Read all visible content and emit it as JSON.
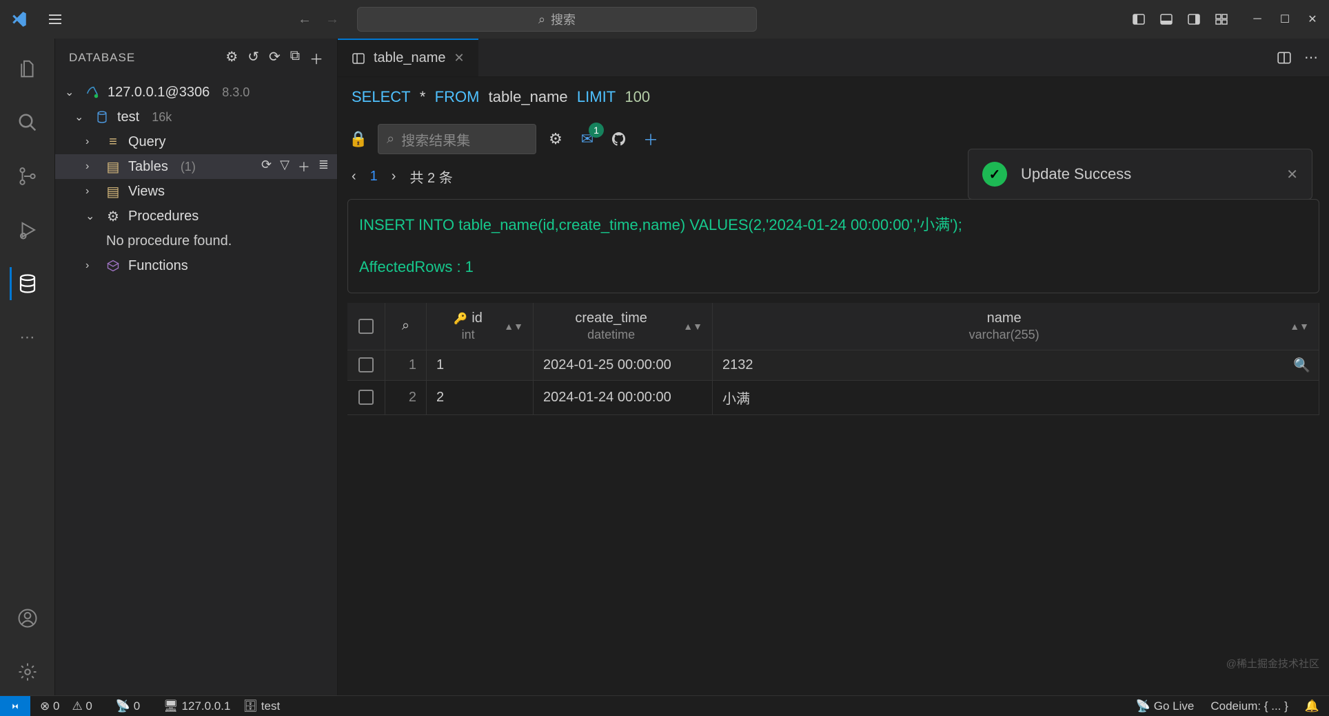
{
  "titlebar": {
    "search_placeholder": "搜索"
  },
  "sidebar": {
    "title": "DATABASE",
    "connection": {
      "label": "127.0.0.1@3306",
      "version": "8.3.0"
    },
    "db": {
      "label": "test",
      "size": "16k"
    },
    "items": {
      "query": "Query",
      "tables": "Tables",
      "tables_count": "(1)",
      "views": "Views",
      "procedures": "Procedures",
      "no_procedure": "No procedure found.",
      "functions": "Functions"
    }
  },
  "tab": {
    "name": "table_name"
  },
  "sql": {
    "select_kw": "SELECT",
    "star": "*",
    "from_kw": "FROM",
    "table": "table_name",
    "limit_kw": "LIMIT",
    "limit_val": "100"
  },
  "result_toolbar": {
    "search_placeholder": "搜索结果集",
    "badge": "1"
  },
  "pager": {
    "page": "1",
    "total_label": "共 2 条"
  },
  "output": {
    "insert": "INSERT INTO table_name(id,create_time,name) VALUES(2,'2024-01-24 00:00:00','小满');",
    "affected": "AffectedRows : 1"
  },
  "columns": {
    "id": {
      "name": "id",
      "type": "int"
    },
    "create_time": {
      "name": "create_time",
      "type": "datetime"
    },
    "name": {
      "name": "name",
      "type": "varchar(255)"
    }
  },
  "rows": [
    {
      "n": "1",
      "id": "1",
      "ct": "2024-01-25 00:00:00",
      "nm": "2132"
    },
    {
      "n": "2",
      "id": "2",
      "ct": "2024-01-24 00:00:00",
      "nm": "小满"
    }
  ],
  "toast": {
    "message": "Update Success"
  },
  "statusbar": {
    "errors": "0",
    "warnings": "0",
    "port": "0",
    "host": "127.0.0.1",
    "db": "test",
    "golive": "Go Live",
    "codeium": "Codeium: { ... }"
  },
  "watermark": "@稀土掘金技术社区"
}
